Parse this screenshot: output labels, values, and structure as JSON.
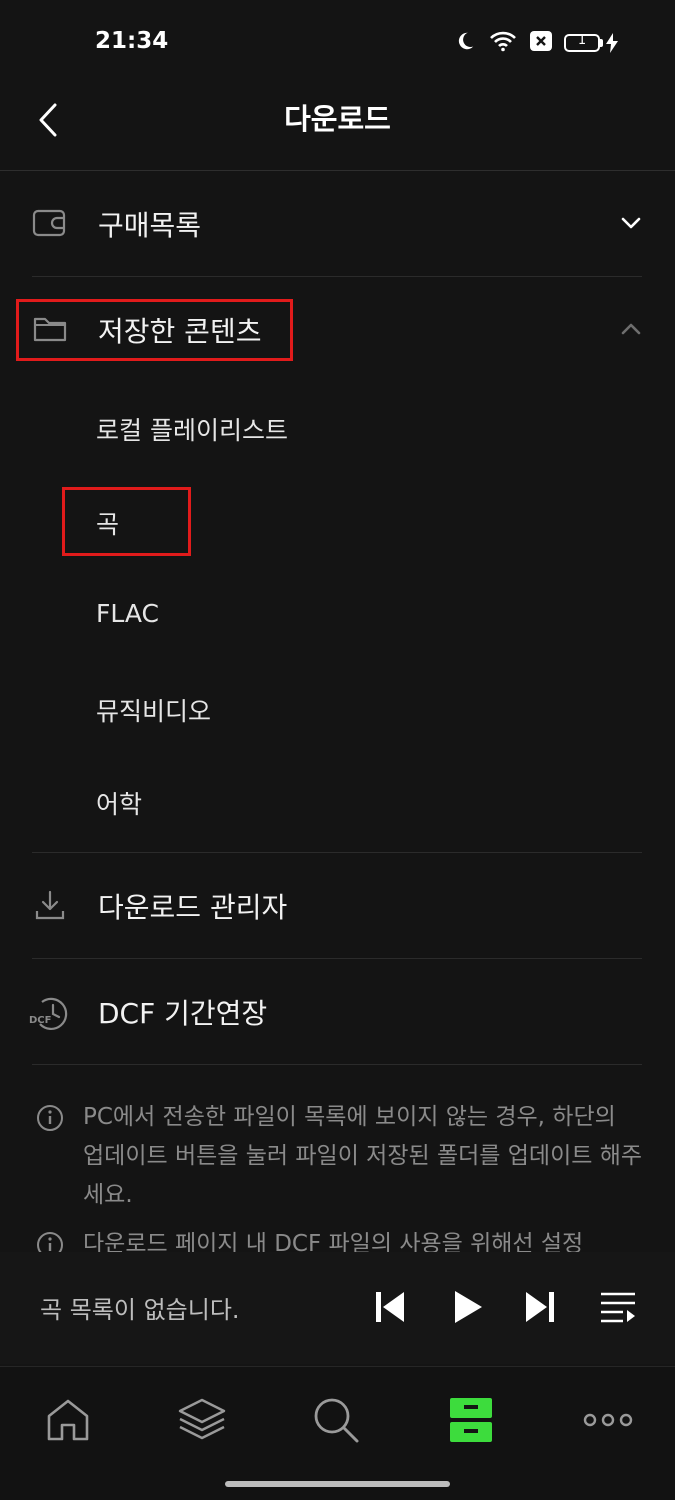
{
  "status_bar": {
    "time": "21:34",
    "battery": "1"
  },
  "header": {
    "title": "다운로드"
  },
  "sections": {
    "purchases": {
      "label": "구매목록"
    },
    "saved": {
      "label": "저장한 콘텐츠",
      "items": [
        "로컬 플레이리스트",
        "곡",
        "FLAC",
        "뮤직비디오",
        "어학"
      ]
    },
    "download_manager": {
      "label": "다운로드 관리자"
    },
    "dcf": {
      "label": "DCF 기간연장",
      "icon_text": "DCF"
    }
  },
  "notices": [
    "PC에서 전송한 파일이 목록에 보이지 않는 경우, 하단의 업데이트 버튼을 눌러 파일이 저장된 폴더를 업데이트 해주세요.",
    "다운로드 페이지 내 DCF 파일의 사용을 위해선 설정"
  ],
  "player": {
    "empty_message": "곡 목록이 없습니다."
  },
  "bottom_nav": [
    "home-icon",
    "layers-icon",
    "search-icon",
    "storage-icon",
    "more-icon"
  ],
  "colors": {
    "accent": "#3ddc3d",
    "highlight_box": "#e11b1b",
    "background": "#141414"
  }
}
